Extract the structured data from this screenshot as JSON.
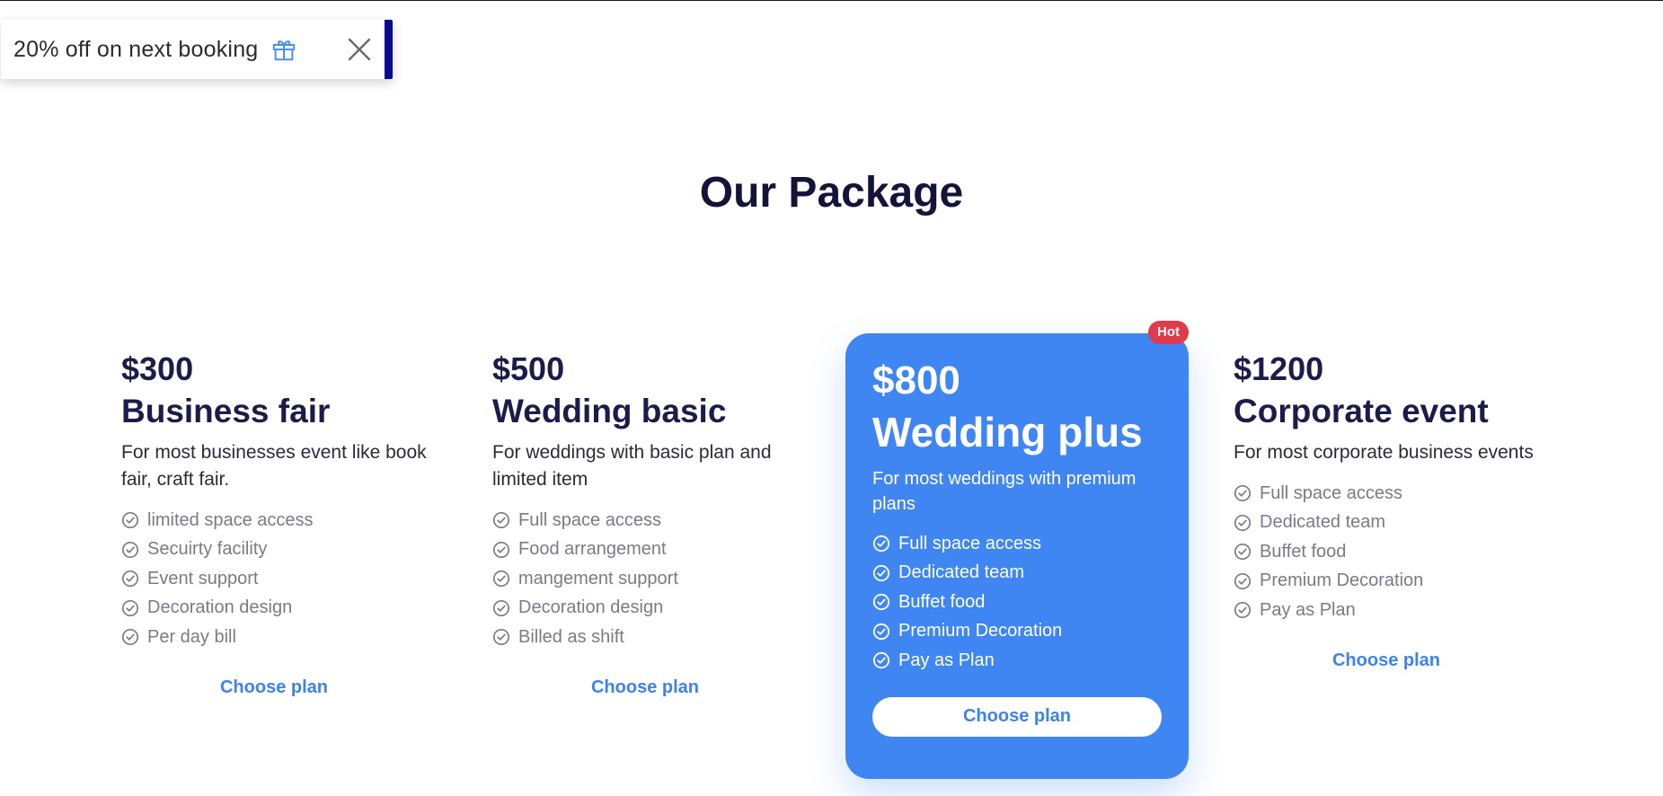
{
  "toast": {
    "text": "20% off on next booking",
    "gift_icon": "gift-icon",
    "close_icon": "close-icon",
    "icon_color": "#4a90e8",
    "bar_color": "#0a0a8c"
  },
  "section": {
    "title": "Our Package"
  },
  "plans": [
    {
      "price": "$300",
      "name": "Business fair",
      "description": "For most businesses event like book fair, craft fair.",
      "features": [
        "limited space access",
        "Secuirty facility",
        "Event support",
        "Decoration design",
        "Per day bill"
      ],
      "cta": "Choose plan"
    },
    {
      "price": "$500",
      "name": "Wedding basic",
      "description": "For weddings with basic plan and limited item",
      "features": [
        "Full space access",
        "Food arrangement",
        "mangement support",
        "Decoration design",
        "Billed as shift"
      ],
      "cta": "Choose plan"
    },
    {
      "price": "$800",
      "name": "Wedding plus",
      "description": "For most weddings with premium plans",
      "badge": "Hot",
      "features": [
        "Full space access",
        "Dedicated team",
        "Buffet food",
        "Premium Decoration",
        "Pay as Plan"
      ],
      "cta": "Choose plan",
      "featured": true
    },
    {
      "price": "$1200",
      "name": "Corporate event",
      "description": "For most corporate business events",
      "features": [
        "Full space access",
        "Dedicated team",
        "Buffet food",
        "Premium Decoration",
        "Pay as Plan"
      ],
      "cta": "Choose plan"
    }
  ],
  "colors": {
    "accent": "#3f86f2",
    "badge": "#e03a4c",
    "heading": "#1c1c4a"
  }
}
